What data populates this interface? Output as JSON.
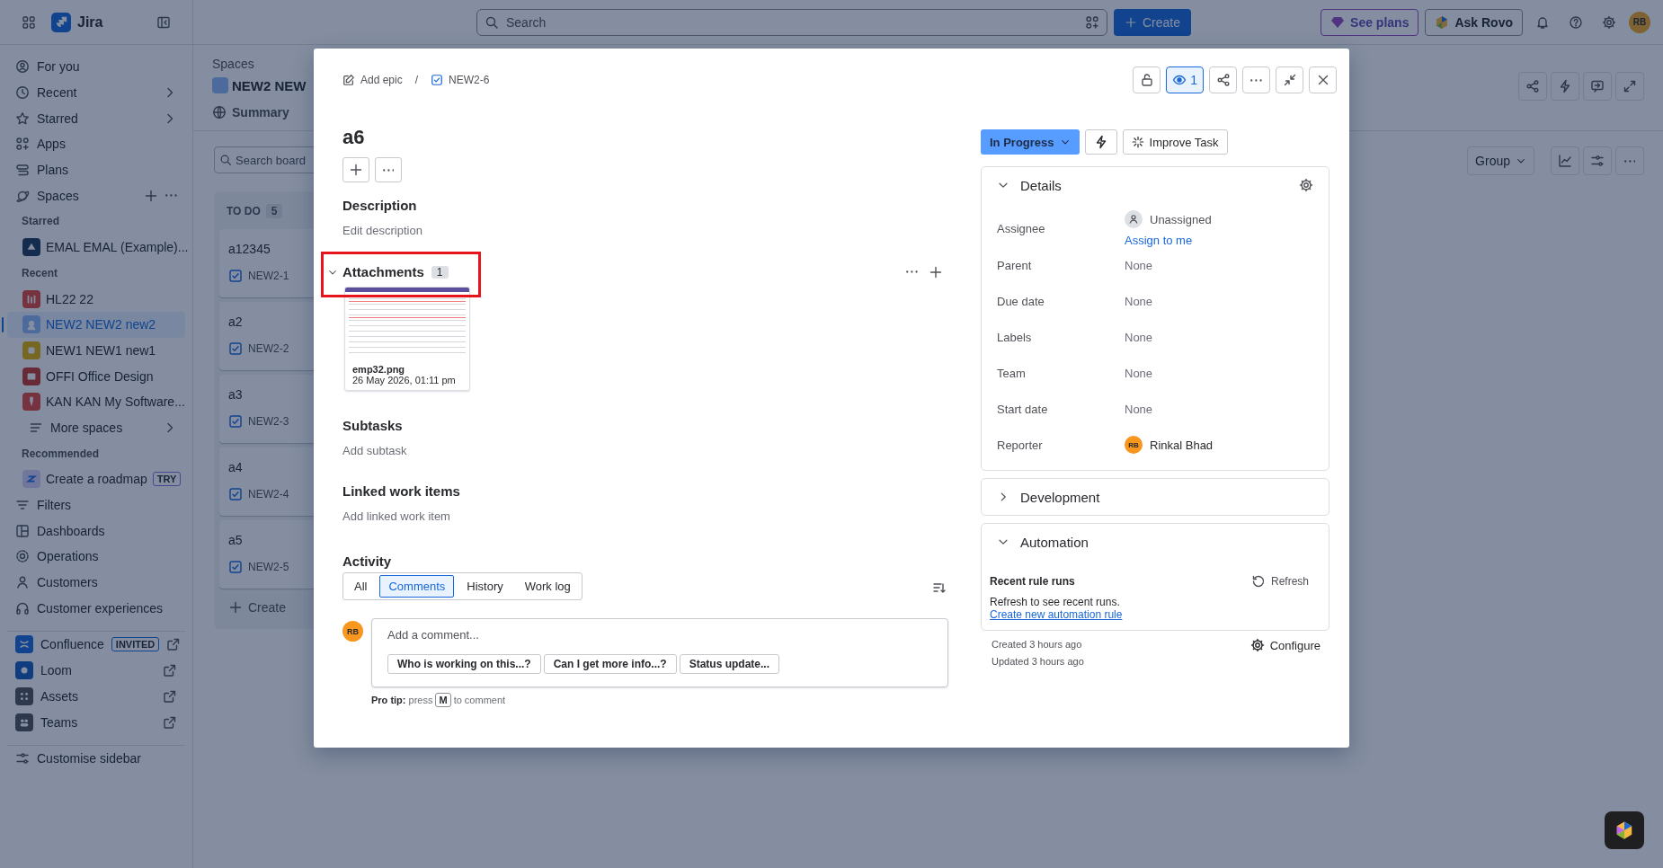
{
  "top_bar": {
    "app_name": "Jira",
    "search": {
      "placeholder": "Search"
    },
    "create_button": "Create",
    "see_plans_button": "See plans",
    "ask_rovo_button": "Ask Rovo",
    "avatar_initials": "RB"
  },
  "sidebar": {
    "items": [
      {
        "kind": "nav",
        "label": "For you",
        "expandable": false,
        "selected": false
      },
      {
        "kind": "nav",
        "label": "Recent",
        "expandable": true,
        "selected": false
      },
      {
        "kind": "nav",
        "label": "Starred",
        "expandable": true,
        "selected": false
      },
      {
        "kind": "nav",
        "label": "Apps",
        "expandable": false,
        "selected": false
      },
      {
        "kind": "nav",
        "label": "Plans",
        "expandable": false,
        "selected": false
      },
      {
        "kind": "section",
        "label": "Spaces",
        "selected": false
      },
      {
        "kind": "heading",
        "label": "Starred"
      },
      {
        "kind": "space",
        "label": "EMAL EMAL (Example)...",
        "selected": false
      },
      {
        "kind": "heading",
        "label": "Recent"
      },
      {
        "kind": "space",
        "label": "HL22 22",
        "selected": false
      },
      {
        "kind": "space",
        "label": "NEW2 NEW2 new2",
        "selected": true
      },
      {
        "kind": "space",
        "label": "NEW1 NEW1 new1",
        "selected": false
      },
      {
        "kind": "space",
        "label": "OFFI Office Design",
        "selected": false
      },
      {
        "kind": "space",
        "label": "KAN KAN My Software...",
        "selected": false
      },
      {
        "kind": "more",
        "label": "More spaces",
        "expandable": true,
        "selected": false
      },
      {
        "kind": "heading",
        "label": "Recommended"
      },
      {
        "kind": "space",
        "label": "Create a roadmap",
        "badge": "TRY",
        "selected": false
      },
      {
        "kind": "nav",
        "label": "Filters",
        "expandable": false,
        "selected": false
      },
      {
        "kind": "nav",
        "label": "Dashboards",
        "expandable": false,
        "selected": false
      },
      {
        "kind": "nav",
        "label": "Operations",
        "expandable": false,
        "selected": false
      },
      {
        "kind": "nav",
        "label": "Customers",
        "expandable": false,
        "selected": false
      },
      {
        "kind": "nav",
        "label": "Customer experiences",
        "expandable": false,
        "selected": false
      },
      {
        "kind": "app",
        "label": "Confluence",
        "badge": "INVITED",
        "selected": false
      },
      {
        "kind": "app",
        "label": "Loom",
        "selected": false
      },
      {
        "kind": "app",
        "label": "Assets",
        "selected": false
      },
      {
        "kind": "app",
        "label": "Teams",
        "selected": false
      },
      {
        "kind": "footer",
        "label": "Customise sidebar",
        "selected": false
      }
    ]
  },
  "board": {
    "breadcrumb": "Spaces",
    "title": "NEW2 NEW",
    "tabs": [
      {
        "label": "Summary",
        "selected": false
      }
    ],
    "search": {
      "placeholder": "Search board"
    },
    "group_button": "Group",
    "column": {
      "title": "TO DO",
      "count": "5",
      "cards": [
        {
          "title": "a12345",
          "key": "NEW2-1"
        },
        {
          "title": "a2",
          "key": "NEW2-2"
        },
        {
          "title": "a3",
          "key": "NEW2-3"
        },
        {
          "title": "a4",
          "key": "NEW2-4"
        },
        {
          "title": "a5",
          "key": "NEW2-5"
        }
      ],
      "create": "Create"
    }
  },
  "modal": {
    "breadcrumb": {
      "parent": "Add epic",
      "separator": "/",
      "key": "NEW2-6"
    },
    "watchers": {
      "count": "1",
      "watching": true
    },
    "title": "a6",
    "description": {
      "heading": "Description",
      "placeholder": "Edit description"
    },
    "attachments": {
      "heading": "Attachments",
      "count": "1",
      "highlighted": true,
      "files": [
        {
          "kind": "picture",
          "name": "emp32.png",
          "date": "26 May 2026, 01:11 pm"
        }
      ]
    },
    "subtasks": {
      "heading": "Subtasks",
      "action": "Add subtask"
    },
    "linked": {
      "heading": "Linked work items",
      "action": "Add linked work item"
    },
    "activity": {
      "heading": "Activity",
      "tabs": [
        {
          "label": "All",
          "selected": false
        },
        {
          "label": "Comments",
          "selected": true
        },
        {
          "label": "History",
          "selected": false
        },
        {
          "label": "Work log",
          "selected": false
        }
      ],
      "comment": {
        "avatar": "RB",
        "placeholder": "Add a comment...",
        "suggestions": [
          "Who is working on this...?",
          "Can I get more info...?",
          "Status update..."
        ]
      },
      "pro_tip": {
        "before": "**Pro tip:** press",
        "key": "M",
        "after": "to comment"
      }
    },
    "status_button": "In Progress",
    "improve_button": "Improve Task",
    "details": {
      "heading": "Details",
      "expanded": true,
      "fields": [
        {
          "kind": "unassigned",
          "label": "Assignee",
          "value": "Unassigned",
          "action": "Assign to me"
        },
        {
          "kind": "empty",
          "label": "Parent",
          "value": "None"
        },
        {
          "kind": "empty",
          "label": "Due date",
          "value": "None"
        },
        {
          "kind": "empty",
          "label": "Labels",
          "value": "None"
        },
        {
          "kind": "empty",
          "label": "Team",
          "value": "None"
        },
        {
          "kind": "empty",
          "label": "Start date",
          "value": "None"
        },
        {
          "kind": "user",
          "label": "Reporter",
          "value": "Rinkal Bhad",
          "avatar": "RB"
        }
      ]
    },
    "development": {
      "heading": "Development",
      "expanded": false
    },
    "automation": {
      "heading": "Automation",
      "expanded": true,
      "runs_title": "Recent rule runs",
      "refresh_button": "Refresh",
      "message": "Refresh to see recent runs.",
      "link": "Create new automation rule"
    },
    "footer": {
      "created": "Created 3 hours ago",
      "updated": "Updated 3 hours ago",
      "configure_button": "Configure"
    }
  }
}
